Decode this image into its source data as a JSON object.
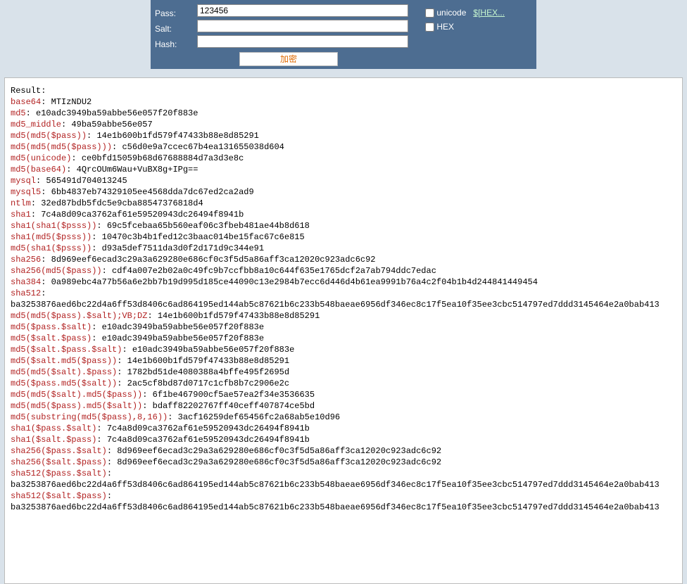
{
  "form": {
    "pass_label": "Pass:",
    "salt_label": "Salt:",
    "hash_label": "Hash:",
    "pass_value": "123456",
    "salt_value": "",
    "hash_value": "",
    "btn_label": "加密",
    "unicode_label": "unicode",
    "hex_label": "HEX",
    "hex_link": "$[HEX..."
  },
  "result": {
    "title": "Result:",
    "rows": [
      {
        "k": "base64",
        "v": "MTIzNDU2"
      },
      {
        "k": "md5",
        "v": "e10adc3949ba59abbe56e057f20f883e"
      },
      {
        "k": "md5_middle",
        "v": "49ba59abbe56e057"
      },
      {
        "k": "md5(md5($pass))",
        "v": "14e1b600b1fd579f47433b88e8d85291"
      },
      {
        "k": "md5(md5(md5($pass)))",
        "v": "c56d0e9a7ccec67b4ea131655038d604"
      },
      {
        "k": "md5(unicode)",
        "v": "ce0bfd15059b68d67688884d7a3d3e8c"
      },
      {
        "k": "md5(base64)",
        "v": "4QrcOUm6Wau+VuBX8g+IPg=="
      },
      {
        "k": "mysql",
        "v": "565491d704013245"
      },
      {
        "k": "mysql5",
        "v": "6bb4837eb74329105ee4568dda7dc67ed2ca2ad9"
      },
      {
        "k": "ntlm",
        "v": "32ed87bdb5fdc5e9cba88547376818d4"
      },
      {
        "k": "sha1",
        "v": "7c4a8d09ca3762af61e59520943dc26494f8941b"
      },
      {
        "k": "sha1(sha1($psss))",
        "v": "69c5fcebaa65b560eaf06c3fbeb481ae44b8d618"
      },
      {
        "k": "sha1(md5($psss))",
        "v": "10470c3b4b1fed12c3baac014be15fac67c6e815"
      },
      {
        "k": "md5(sha1($psss))",
        "v": "d93a5def7511da3d0f2d171d9c344e91"
      },
      {
        "k": "sha256",
        "v": "8d969eef6ecad3c29a3a629280e686cf0c3f5d5a86aff3ca12020c923adc6c92"
      },
      {
        "k": "sha256(md5($pass))",
        "v": "cdf4a007e2b02a0c49fc9b7ccfbb8a10c644f635e1765dcf2a7ab794ddc7edac"
      },
      {
        "k": "sha384",
        "v": "0a989ebc4a77b56a6e2bb7b19d995d185ce44090c13e2984b7ecc6d446d4b61ea9991b76a4c2f04b1b4d244841449454"
      },
      {
        "k": "sha512",
        "v": ""
      },
      {
        "k": "",
        "v": "ba3253876aed6bc22d4a6ff53d8406c6ad864195ed144ab5c87621b6c233b548baeae6956df346ec8c17f5ea10f35ee3cbc514797ed7ddd3145464e2a0bab413"
      },
      {
        "k": "md5(md5($pass).$salt);VB;DZ",
        "v": "14e1b600b1fd579f47433b88e8d85291"
      },
      {
        "k": "md5($pass.$salt)",
        "v": "e10adc3949ba59abbe56e057f20f883e"
      },
      {
        "k": "md5($salt.$pass)",
        "v": "e10adc3949ba59abbe56e057f20f883e"
      },
      {
        "k": "md5($salt.$pass.$salt)",
        "v": "e10adc3949ba59abbe56e057f20f883e"
      },
      {
        "k": "md5($salt.md5($pass))",
        "v": "14e1b600b1fd579f47433b88e8d85291"
      },
      {
        "k": "md5(md5($salt).$pass)",
        "v": "1782bd51de4080388a4bffe495f2695d"
      },
      {
        "k": "md5($pass.md5($salt))",
        "v": "2ac5cf8bd87d0717c1cfb8b7c2906e2c"
      },
      {
        "k": "md5(md5($salt).md5($pass))",
        "v": "6f1be467900cf5ae57ea2f34e3536635"
      },
      {
        "k": "md5(md5($pass).md5($salt))",
        "v": "bdaff82202767ff40ceff407874ce5bd"
      },
      {
        "k": "md5(substring(md5($pass),8,16))",
        "v": "3acf16259def65456fc2a68ab5e10d96"
      },
      {
        "k": "sha1($pass.$salt)",
        "v": "7c4a8d09ca3762af61e59520943dc26494f8941b"
      },
      {
        "k": "sha1($salt.$pass)",
        "v": "7c4a8d09ca3762af61e59520943dc26494f8941b"
      },
      {
        "k": "sha256($pass.$salt)",
        "v": "8d969eef6ecad3c29a3a629280e686cf0c3f5d5a86aff3ca12020c923adc6c92"
      },
      {
        "k": "sha256($salt.$pass)",
        "v": "8d969eef6ecad3c29a3a629280e686cf0c3f5d5a86aff3ca12020c923adc6c92"
      },
      {
        "k": "sha512($pass.$salt)",
        "v": ""
      },
      {
        "k": "",
        "v": "ba3253876aed6bc22d4a6ff53d8406c6ad864195ed144ab5c87621b6c233b548baeae6956df346ec8c17f5ea10f35ee3cbc514797ed7ddd3145464e2a0bab413"
      },
      {
        "k": "sha512($salt.$pass)",
        "v": ""
      },
      {
        "k": "",
        "v": "ba3253876aed6bc22d4a6ff53d8406c6ad864195ed144ab5c87621b6c233b548baeae6956df346ec8c17f5ea10f35ee3cbc514797ed7ddd3145464e2a0bab413"
      }
    ]
  }
}
